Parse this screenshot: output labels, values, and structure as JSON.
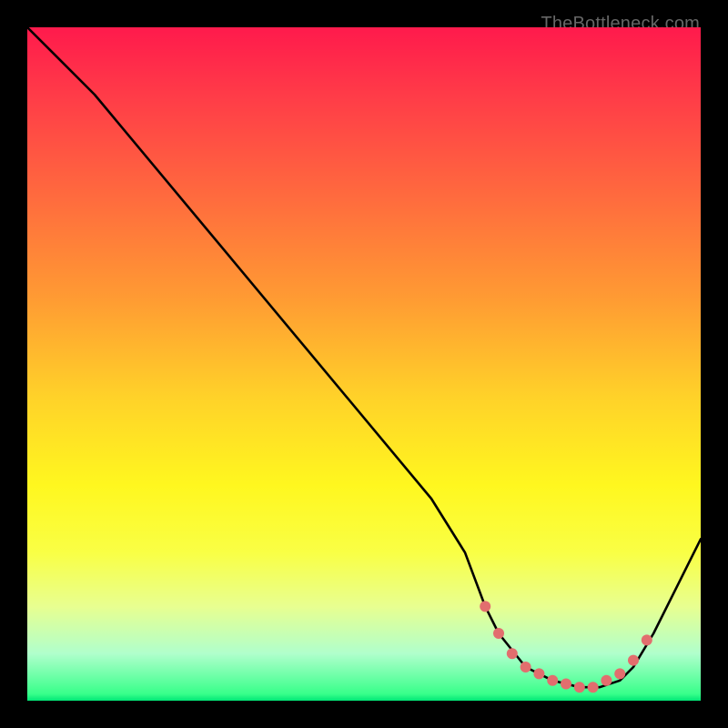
{
  "watermark": "TheBottleneck.com",
  "chart_data": {
    "type": "line",
    "title": "",
    "xlabel": "",
    "ylabel": "",
    "xlim": [
      0,
      100
    ],
    "ylim": [
      0,
      100
    ],
    "series": [
      {
        "name": "bottleneck-curve",
        "x": [
          0,
          4,
          10,
          20,
          30,
          40,
          50,
          60,
          65,
          68,
          70,
          74,
          78,
          82,
          85,
          88,
          90,
          93,
          97,
          100
        ],
        "y": [
          100,
          96,
          90,
          78,
          66,
          54,
          42,
          30,
          22,
          14,
          10,
          5,
          3,
          2,
          2,
          3,
          5,
          10,
          18,
          24
        ]
      }
    ],
    "markers": {
      "name": "sweet-spot-points",
      "color": "#e26e6e",
      "x": [
        68,
        70,
        72,
        74,
        76,
        78,
        80,
        82,
        84,
        86,
        88,
        90,
        92
      ],
      "y": [
        14,
        10,
        7,
        5,
        4,
        3,
        2.5,
        2,
        2,
        3,
        4,
        6,
        9
      ]
    }
  }
}
